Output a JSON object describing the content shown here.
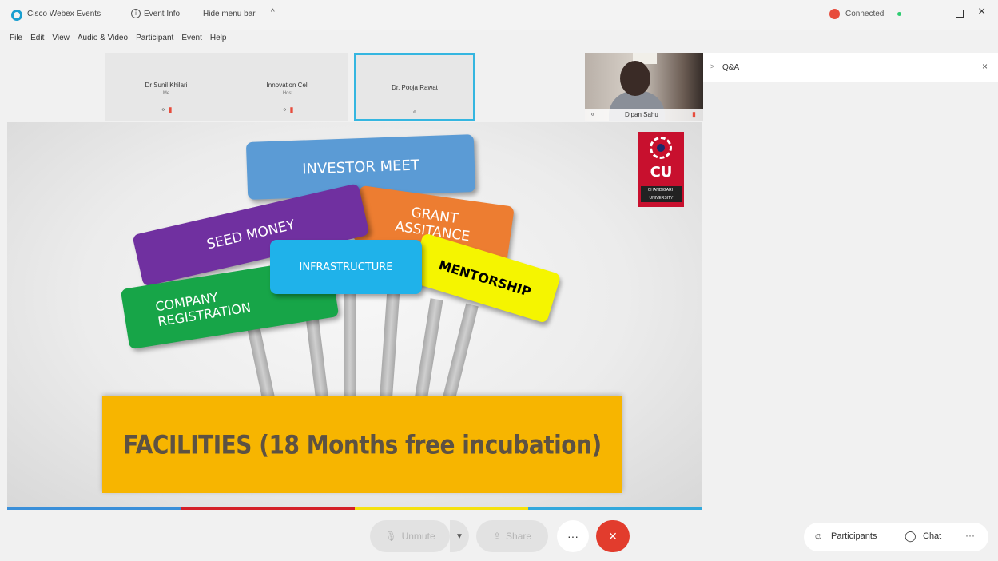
{
  "titlebar": {
    "app_name": "Cisco Webex Events",
    "event_info": "Event Info",
    "hide_menu": "Hide menu bar",
    "hide_chevron": "^",
    "connection": "Connected",
    "minimize": "—",
    "close": "×"
  },
  "menu": [
    "File",
    "Edit",
    "View",
    "Audio & Video",
    "Participant",
    "Event",
    "Help"
  ],
  "thumbnails": [
    {
      "name": "Dr Sunil Khilari",
      "role": "Me"
    },
    {
      "name": "Innovation Cell",
      "role": "Host"
    },
    {
      "name": "Dr. Pooja Rawat",
      "role": ""
    }
  ],
  "video": {
    "name": "Dipan Sahu"
  },
  "slide": {
    "signs": {
      "investor_meet": "INVESTOR MEET",
      "grant_assitance": "GRANT ASSITANCE",
      "seed_money": "SEED MONEY",
      "infrastructure": "INFRASTRUCTURE",
      "mentorship": "MENTORSHIP",
      "company_registration": "COMPANY REGISTRATION"
    },
    "banner": "FACILITIES (18 Months free incubation)",
    "logo": {
      "letters": "CU",
      "subtitle": "CHANDIGARH UNIVERSITY"
    }
  },
  "colorbar": [
    "#3a8fd9",
    "#d42027",
    "#f5e10d",
    "#32a8dc"
  ],
  "qa": {
    "title": "Q&A",
    "close": "×"
  },
  "controls": {
    "unmute": "Unmute",
    "share": "Share",
    "more": "···",
    "leave": "×"
  },
  "bottom_right": {
    "participants": "Participants",
    "chat": "Chat",
    "more": "···"
  }
}
